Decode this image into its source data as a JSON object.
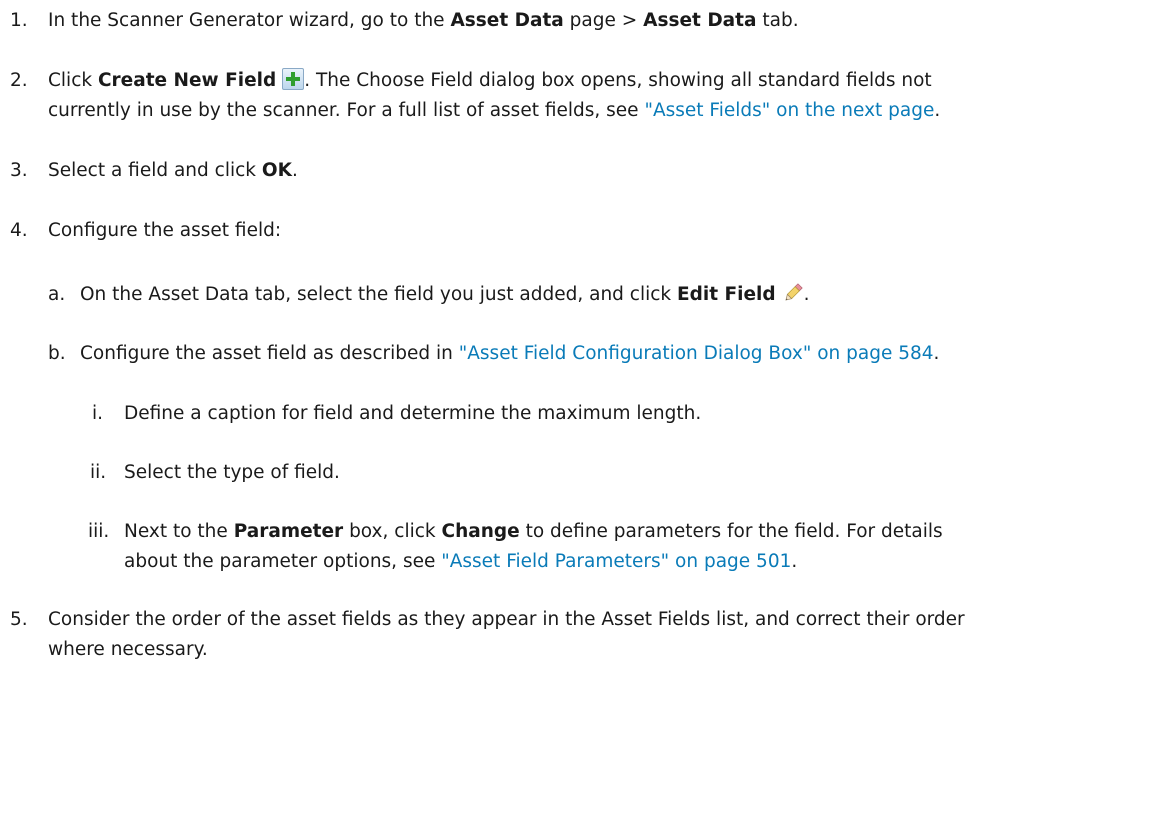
{
  "steps": {
    "s1": {
      "num": "1.",
      "pre": "In the Scanner Generator wizard, go to the ",
      "b1": "Asset Data",
      "mid": " page > ",
      "b2": "Asset Data",
      "post": " tab."
    },
    "s2": {
      "num": "2.",
      "pre": "Click ",
      "b1": "Create New Field",
      "icon": "add-field-icon",
      "line1": ". The Choose Field dialog box opens, showing all standard fields not",
      "line2_pre": "currently in use by the scanner. For a full list of asset fields, see ",
      "link": "\"Asset Fields\" on the next page",
      "line2_post": "."
    },
    "s3": {
      "num": "3.",
      "pre": "Select a field and click ",
      "b1": "OK",
      "post": "."
    },
    "s4": {
      "num": "4.",
      "text": "Configure the asset field:",
      "a": {
        "num": "a.",
        "pre": "On the Asset Data tab, select the field you just added, and click ",
        "b1": "Edit Field",
        "icon": "pencil-icon",
        "post": "."
      },
      "b": {
        "num": "b.",
        "pre": "Configure the asset field as described in ",
        "link": "\"Asset Field Configuration Dialog Box\" on page 584",
        "post": ".",
        "i": {
          "num": "i.",
          "text": "Define a caption for field and determine the maximum length."
        },
        "ii": {
          "num": "ii.",
          "text": "Select the type of field."
        },
        "iii": {
          "num": "iii.",
          "pre": "Next to the ",
          "b1": "Parameter",
          "mid": " box, click ",
          "b2": "Change",
          "line1_post": " to define parameters for the field. For details",
          "line2_pre": "about the parameter options, see ",
          "link": "\"Asset Field Parameters\" on page 501",
          "line2_post": "."
        }
      }
    },
    "s5": {
      "num": "5.",
      "line1": "Consider the order of the asset fields as they appear in the Asset Fields list, and correct their order",
      "line2": "where necessary."
    }
  },
  "colors": {
    "link": "#0a7bb8",
    "text": "#1a1a1a"
  }
}
